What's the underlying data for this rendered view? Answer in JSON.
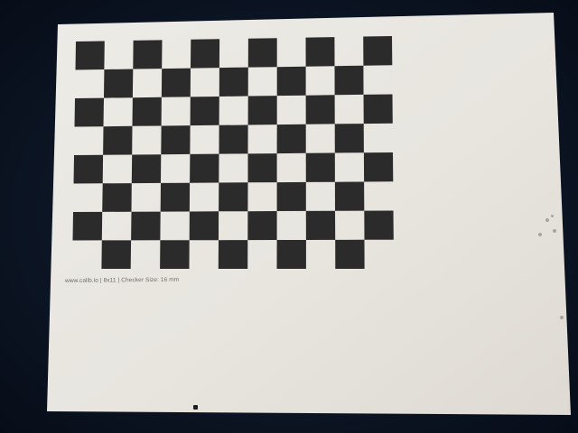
{
  "caption": "www.calib.io | 8x11 | Checker Size: 16 mm",
  "board": {
    "rows": 8,
    "cols": 11,
    "dark_color": "#2b2b2b",
    "paper_color": "#e9e6e0",
    "background_color": "#0c1524"
  }
}
